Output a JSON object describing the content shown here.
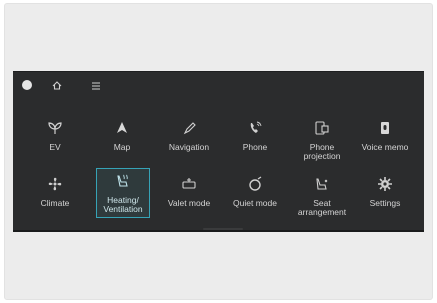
{
  "colors": {
    "screen_bg": "#2b2c2d",
    "text": "#d4d4d4",
    "accent": "#36a3b6"
  },
  "topbar": {
    "icons": [
      "home-button",
      "house-icon",
      "menu-icon"
    ]
  },
  "menu": {
    "row1": [
      {
        "label": "EV",
        "icon": "leaf-icon"
      },
      {
        "label": "Map",
        "icon": "arrow-up-icon"
      },
      {
        "label": "Navigation",
        "icon": "compass-icon"
      },
      {
        "label": "Phone",
        "icon": "phone-icon"
      },
      {
        "label": "Phone\nprojection",
        "icon": "phone-projection-icon"
      },
      {
        "label": "Voice memo",
        "icon": "voice-memo-icon"
      }
    ],
    "row2": [
      {
        "label": "Climate",
        "icon": "fan-icon"
      },
      {
        "label": "Heating/\nVentilation",
        "icon": "seat-heating-icon",
        "selected": true
      },
      {
        "label": "Valet mode",
        "icon": "valet-icon"
      },
      {
        "label": "Quiet mode",
        "icon": "quiet-icon"
      },
      {
        "label": "Seat\narrangement",
        "icon": "seat-icon"
      },
      {
        "label": "Settings",
        "icon": "gear-icon"
      }
    ]
  }
}
